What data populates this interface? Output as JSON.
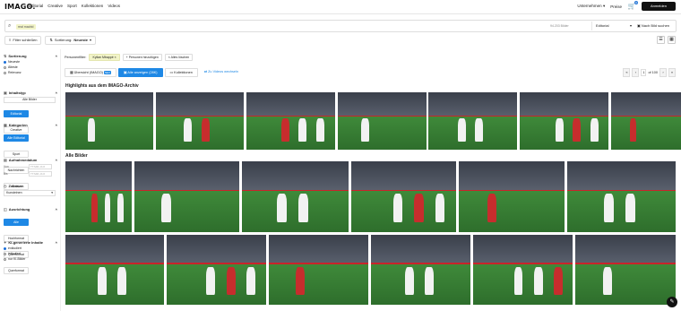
{
  "nav": {
    "logo": "IMAGO.",
    "links": [
      "Editorial",
      "Creative",
      "Sport",
      "Kollektionen",
      "Videos"
    ],
    "company": "Unternehmen",
    "prices": "Preise",
    "cart_count": "0",
    "login": "Anmelden"
  },
  "search": {
    "query_chip": "real madrid",
    "count": "94.203 Bilder",
    "collection": "Editorial",
    "image_search": "Nach Bild suchen"
  },
  "filters": {
    "hide_filters": "Filter schließen",
    "sort_prefix": "Sortierung:",
    "sort_value": "Neueste"
  },
  "sidebar": {
    "sort_title": "Sortierung",
    "sort_options": [
      "Neueste",
      "Älteste",
      "Relevanz"
    ],
    "type_title": "Inhaltstyp",
    "type_all": "Alle Bilder",
    "type_editorial": "Editorial",
    "type_creative": "Creative",
    "cat_title": "Kategorien",
    "cat_items": [
      "Alle Editorial",
      "Sport",
      "Nachrichten",
      "Archiv"
    ],
    "date_title": "Aufnahmedatum",
    "date_from": "Von",
    "date_to": "Bis",
    "date_placeholder": "TT.MM.JJJJ",
    "period_title": "Zeitraum",
    "period_value": "Kunsteinen",
    "orient_title": "Ausrichtung",
    "orient_items": [
      "Alle",
      "Hochformat",
      "Querformat",
      "Querformat"
    ],
    "ai_title": "KI-generierte Inhalte",
    "ai_options": [
      "exkludiert",
      "inkludiert",
      "nur KI-Bilder"
    ]
  },
  "main": {
    "pers_label": "Personenfilter:",
    "pers_tags": [
      "Kylian Mbappé",
      "Personen hinzufügen"
    ],
    "pers_clear": "Alles löschen",
    "tab_overview": "Übersicht (IMAGO)",
    "tab_new": "NEU",
    "tab_all": "Alle anzeigen (28K)",
    "tab_collections": "Kollektionen",
    "tab_videos": "Zu Videos wechseln",
    "page_current": "1",
    "page_total": "of 100",
    "highlights_title": "Highlights aus dem IMAGO-Archiv",
    "all_title": "Alle Bilder"
  },
  "colors": {
    "accent": "#1e88e5",
    "chip": "#f2f4c8",
    "pitch": "#3f8a3a",
    "board": "#c9242a"
  }
}
